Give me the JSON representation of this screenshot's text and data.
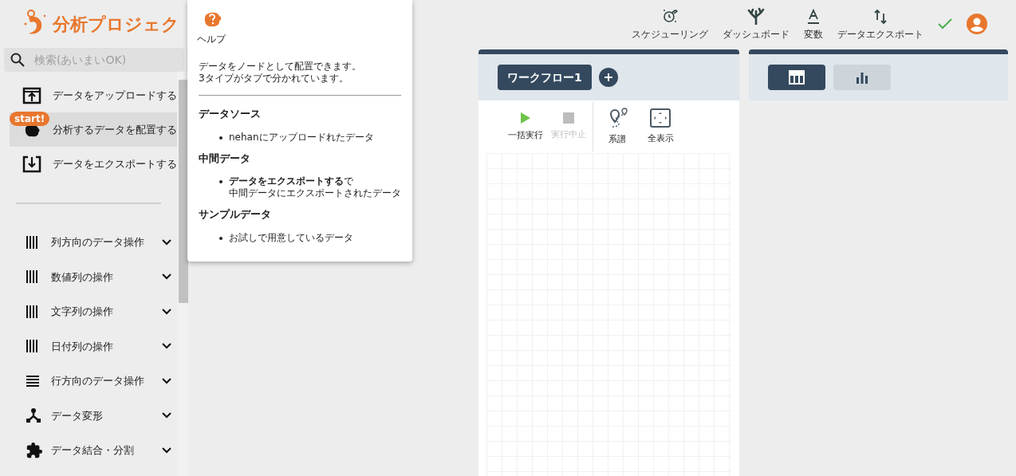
{
  "logo": {
    "text": "分析プロジェク"
  },
  "search": {
    "placeholder": "検索(あいまいOK)"
  },
  "sidebar": {
    "actions": [
      {
        "label": "データをアップロードする",
        "kind": "upload",
        "selected": false
      },
      {
        "label": "分析するデータを配置する",
        "kind": "place",
        "selected": true,
        "badge": "start!"
      },
      {
        "label": "データをエクスポートする",
        "kind": "export",
        "selected": false
      }
    ],
    "categories": [
      {
        "label": "列方向のデータ操作",
        "kind": "columns",
        "expanded": false
      },
      {
        "label": "数値列の操作",
        "kind": "columns",
        "expanded": false
      },
      {
        "label": "文字列の操作",
        "kind": "columns",
        "expanded": false
      },
      {
        "label": "日付列の操作",
        "kind": "columns",
        "expanded": false
      },
      {
        "label": "行方向のデータ操作",
        "kind": "rows",
        "expanded": false
      },
      {
        "label": "データ変形",
        "kind": "transform",
        "expanded": false
      },
      {
        "label": "データ結合・分割",
        "kind": "puzzle",
        "expanded": false
      }
    ]
  },
  "help_popover": {
    "title": "ヘルプ",
    "intro": "データをノードとして配置できます。\n3タイプがタブで分かれています。",
    "sections": [
      {
        "heading": "データソース",
        "items": [
          {
            "lines": [
              "nehanにアップロードれたデータ"
            ]
          }
        ]
      },
      {
        "heading": "中間データ",
        "items": [
          {
            "lines": [
              "**データをエクスポートする**で",
              "中間データにエクスポートされたデータ"
            ]
          }
        ]
      },
      {
        "heading": "サンプルデータ",
        "items": [
          {
            "lines": [
              "お試しで用意しているデータ"
            ]
          }
        ]
      }
    ]
  },
  "header": {
    "items": [
      {
        "label": "スケジューリング",
        "kind": "schedule"
      },
      {
        "label": "ダッシュボード",
        "kind": "dashboard"
      },
      {
        "label": "変数",
        "kind": "variable"
      },
      {
        "label": "データエクスポート",
        "kind": "export"
      }
    ],
    "saved": true
  },
  "workflow": {
    "tabs": [
      {
        "label": "ワークフロー1",
        "selected": true
      }
    ],
    "toolbar": [
      {
        "label": "一括実行",
        "kind": "run",
        "disabled": false
      },
      {
        "label": "実行中止",
        "kind": "stop",
        "disabled": true
      },
      {
        "label": "系譜",
        "kind": "lineage",
        "disabled": false
      },
      {
        "label": "全表示",
        "kind": "fit",
        "disabled": false
      }
    ]
  },
  "view_tabs": [
    {
      "kind": "table",
      "selected": true
    },
    {
      "kind": "chart",
      "selected": false
    }
  ]
}
